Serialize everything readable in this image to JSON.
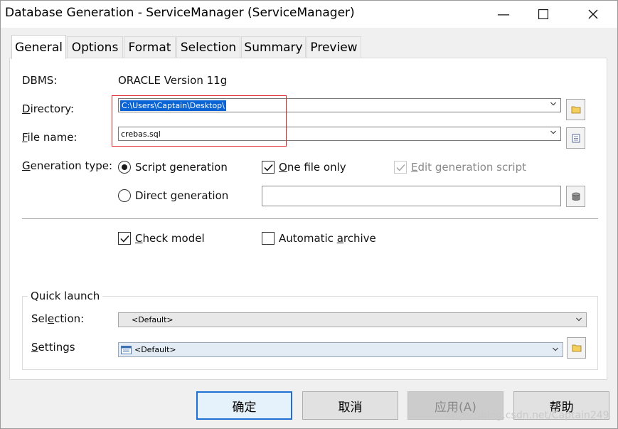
{
  "window": {
    "title": "Database Generation - ServiceManager (ServiceManager)",
    "minimize_glyph": "—",
    "maximize_glyph": "☐",
    "close_glyph": "✕"
  },
  "tabs": [
    {
      "label": "General",
      "active": true
    },
    {
      "label": "Options"
    },
    {
      "label": "Format"
    },
    {
      "label": "Selection"
    },
    {
      "label": "Summary"
    },
    {
      "label": "Preview"
    }
  ],
  "general": {
    "dbms_label": "DBMS:",
    "dbms_value": "ORACLE Version 11g",
    "directory_label_pre": "",
    "directory_label_ul": "D",
    "directory_label_post": "irectory:",
    "directory_value": "C:\\Users\\Captain\\Desktop\\",
    "filename_label_ul": "F",
    "filename_label_post": "ile name:",
    "filename_value": "crebas.sql",
    "gentype_label_ul": "G",
    "gentype_label_post": "eneration type:",
    "script_generation": "Script generation",
    "direct_generation": "Direct generation",
    "one_file_only_ul": "O",
    "one_file_only_post": "ne file only",
    "edit_script_ul": "E",
    "edit_script_post": "dit generation script",
    "check_model_ul": "C",
    "check_model_post": "heck model",
    "auto_archive_pre": "Automatic ",
    "auto_archive_ul": "a",
    "auto_archive_post": "rchive"
  },
  "quick_launch": {
    "title": "Quick launch",
    "selection_label_pre": "Sel",
    "selection_label_ul": "e",
    "selection_label_post": "ction:",
    "selection_value": "<Default>",
    "settings_label_ul": "S",
    "settings_label_post": "ettings",
    "settings_value": "<Default>"
  },
  "buttons": {
    "ok": "确定",
    "cancel": "取消",
    "apply": "应用(A)",
    "help": "帮助"
  },
  "watermark": "https://blog.csdn.net/Captain249",
  "colors": {
    "selection_highlight": "#0a64d6",
    "annotation_red": "#e02020",
    "default_button_border": "#1f70d3"
  }
}
